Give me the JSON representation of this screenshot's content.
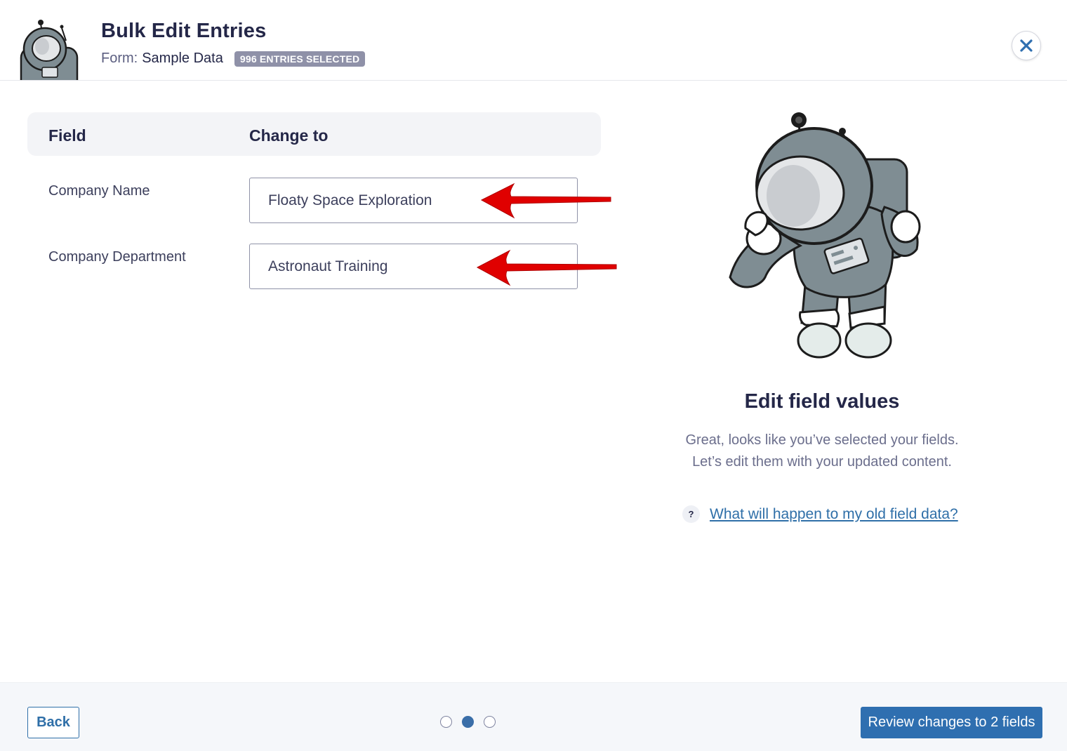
{
  "header": {
    "title": "Bulk Edit Entries",
    "form_prefix": "Form:",
    "form_name": "Sample Data",
    "badge": "996 ENTRIES SELECTED",
    "close_icon": "close-icon"
  },
  "table": {
    "col_field": "Field",
    "col_change": "Change to",
    "rows": [
      {
        "label": "Company Name",
        "value": "Floaty Space Exploration"
      },
      {
        "label": "Company Department",
        "value": "Astronaut Training"
      }
    ]
  },
  "panel": {
    "title": "Edit field values",
    "line1": "Great, looks like you’ve selected your fields.",
    "line2": "Let’s edit them with your updated content.",
    "help_icon": "?",
    "help_link": "What will happen to my old field data?"
  },
  "footer": {
    "back": "Back",
    "step_current": 2,
    "step_total": 3,
    "review": "Review changes to 2 fields"
  },
  "colors": {
    "accent": "#2f6fb0",
    "badge": "#8f91a8",
    "annotation_arrow": "#e00000"
  }
}
